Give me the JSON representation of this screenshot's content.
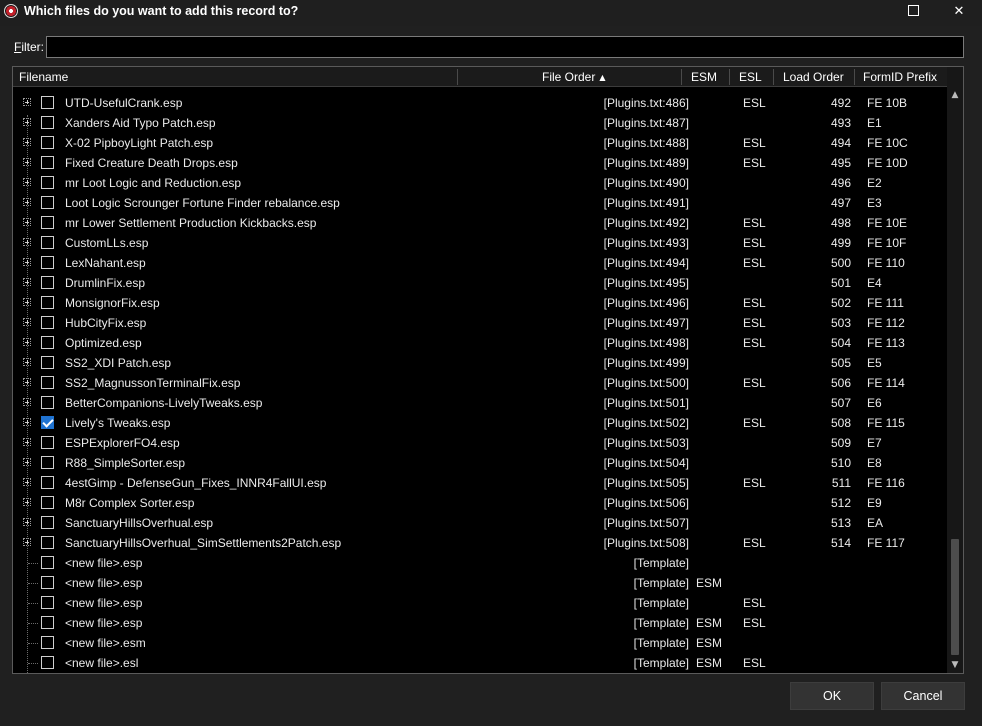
{
  "window": {
    "title": "Which files do you want to add this record to?",
    "maximize_icon": "maximize-icon",
    "close_glyph": "✕"
  },
  "filter": {
    "label_prefix": "F",
    "label_rest": "ilter:",
    "value": ""
  },
  "columns": {
    "filename": "Filename",
    "file_order": "File Order",
    "file_order_sort": "▲",
    "esm": "ESM",
    "esl": "ESL",
    "load_order": "Load Order",
    "formid_prefix": "FormID Prefix"
  },
  "rows": [
    {
      "name": "UTD-UsefulCrank.esp",
      "order": "[Plugins.txt:486]",
      "esm": "",
      "esl": "ESL",
      "load": "492",
      "prefix": "FE 10B",
      "checked": false
    },
    {
      "name": "Xanders Aid Typo Patch.esp",
      "order": "[Plugins.txt:487]",
      "esm": "",
      "esl": "",
      "load": "493",
      "prefix": "E1",
      "checked": false
    },
    {
      "name": "X-02 PipboyLight Patch.esp",
      "order": "[Plugins.txt:488]",
      "esm": "",
      "esl": "ESL",
      "load": "494",
      "prefix": "FE 10C",
      "checked": false
    },
    {
      "name": "Fixed Creature Death Drops.esp",
      "order": "[Plugins.txt:489]",
      "esm": "",
      "esl": "ESL",
      "load": "495",
      "prefix": "FE 10D",
      "checked": false
    },
    {
      "name": "mr Loot Logic and Reduction.esp",
      "order": "[Plugins.txt:490]",
      "esm": "",
      "esl": "",
      "load": "496",
      "prefix": "E2",
      "checked": false
    },
    {
      "name": "Loot Logic Scrounger Fortune Finder rebalance.esp",
      "order": "[Plugins.txt:491]",
      "esm": "",
      "esl": "",
      "load": "497",
      "prefix": "E3",
      "checked": false
    },
    {
      "name": "mr Lower Settlement Production Kickbacks.esp",
      "order": "[Plugins.txt:492]",
      "esm": "",
      "esl": "ESL",
      "load": "498",
      "prefix": "FE 10E",
      "checked": false
    },
    {
      "name": "CustomLLs.esp",
      "order": "[Plugins.txt:493]",
      "esm": "",
      "esl": "ESL",
      "load": "499",
      "prefix": "FE 10F",
      "checked": false
    },
    {
      "name": "LexNahant.esp",
      "order": "[Plugins.txt:494]",
      "esm": "",
      "esl": "ESL",
      "load": "500",
      "prefix": "FE 110",
      "checked": false
    },
    {
      "name": "DrumlinFix.esp",
      "order": "[Plugins.txt:495]",
      "esm": "",
      "esl": "",
      "load": "501",
      "prefix": "E4",
      "checked": false
    },
    {
      "name": "MonsignorFix.esp",
      "order": "[Plugins.txt:496]",
      "esm": "",
      "esl": "ESL",
      "load": "502",
      "prefix": "FE 111",
      "checked": false
    },
    {
      "name": "HubCityFix.esp",
      "order": "[Plugins.txt:497]",
      "esm": "",
      "esl": "ESL",
      "load": "503",
      "prefix": "FE 112",
      "checked": false
    },
    {
      "name": "Optimized.esp",
      "order": "[Plugins.txt:498]",
      "esm": "",
      "esl": "ESL",
      "load": "504",
      "prefix": "FE 113",
      "checked": false
    },
    {
      "name": "SS2_XDI Patch.esp",
      "order": "[Plugins.txt:499]",
      "esm": "",
      "esl": "",
      "load": "505",
      "prefix": "E5",
      "checked": false
    },
    {
      "name": "SS2_MagnussonTerminalFix.esp",
      "order": "[Plugins.txt:500]",
      "esm": "",
      "esl": "ESL",
      "load": "506",
      "prefix": "FE 114",
      "checked": false
    },
    {
      "name": "BetterCompanions-LivelyTweaks.esp",
      "order": "[Plugins.txt:501]",
      "esm": "",
      "esl": "",
      "load": "507",
      "prefix": "E6",
      "checked": false
    },
    {
      "name": "Lively's Tweaks.esp",
      "order": "[Plugins.txt:502]",
      "esm": "",
      "esl": "ESL",
      "load": "508",
      "prefix": "FE 115",
      "checked": true
    },
    {
      "name": "ESPExplorerFO4.esp",
      "order": "[Plugins.txt:503]",
      "esm": "",
      "esl": "",
      "load": "509",
      "prefix": "E7",
      "checked": false
    },
    {
      "name": "R88_SimpleSorter.esp",
      "order": "[Plugins.txt:504]",
      "esm": "",
      "esl": "",
      "load": "510",
      "prefix": "E8",
      "checked": false
    },
    {
      "name": "4estGimp - DefenseGun_Fixes_INNR4FallUI.esp",
      "order": "[Plugins.txt:505]",
      "esm": "",
      "esl": "ESL",
      "load": "511",
      "prefix": "FE 116",
      "checked": false
    },
    {
      "name": "M8r Complex Sorter.esp",
      "order": "[Plugins.txt:506]",
      "esm": "",
      "esl": "",
      "load": "512",
      "prefix": "E9",
      "checked": false
    },
    {
      "name": "SanctuaryHillsOverhual.esp",
      "order": "[Plugins.txt:507]",
      "esm": "",
      "esl": "",
      "load": "513",
      "prefix": "EA",
      "checked": false
    },
    {
      "name": "SanctuaryHillsOverhual_SimSettlements2Patch.esp",
      "order": "[Plugins.txt:508]",
      "esm": "",
      "esl": "ESL",
      "load": "514",
      "prefix": "FE 117",
      "checked": false
    }
  ],
  "templates": [
    {
      "name": "<new file>.esp",
      "order": "[Template]",
      "esm": "",
      "esl": ""
    },
    {
      "name": "<new file>.esp",
      "order": "[Template]",
      "esm": "ESM",
      "esl": ""
    },
    {
      "name": "<new file>.esp",
      "order": "[Template]",
      "esm": "",
      "esl": "ESL"
    },
    {
      "name": "<new file>.esp",
      "order": "[Template]",
      "esm": "ESM",
      "esl": "ESL"
    },
    {
      "name": "<new file>.esm",
      "order": "[Template]",
      "esm": "ESM",
      "esl": ""
    },
    {
      "name": "<new file>.esl",
      "order": "[Template]",
      "esm": "ESM",
      "esl": "ESL"
    }
  ],
  "scrollbar": {
    "up_glyph": "▲",
    "down_glyph": "▼"
  },
  "buttons": {
    "ok": "OK",
    "cancel": "Cancel"
  }
}
